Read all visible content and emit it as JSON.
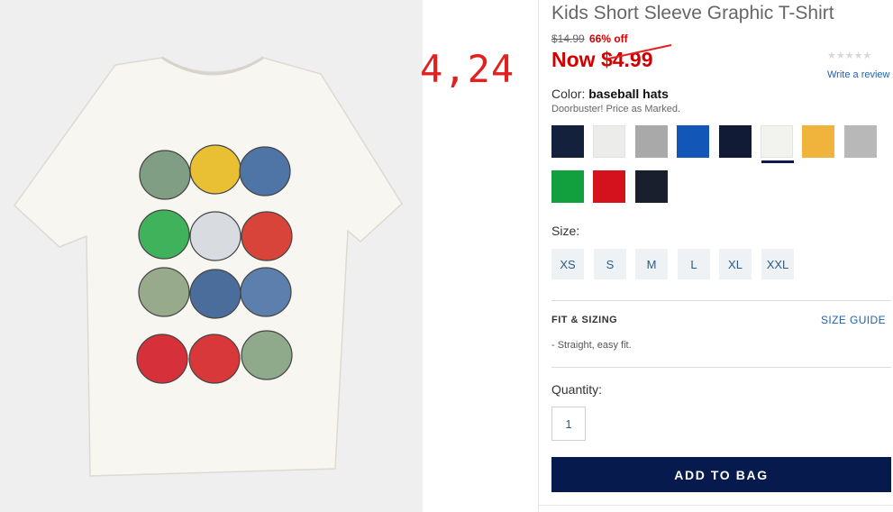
{
  "product": {
    "title": "Kids Short Sleeve Graphic T-Shirt",
    "was_price": "$14.99",
    "discount": "66% off",
    "now_prefix": "Now",
    "now_amount": "$4.99",
    "rating_stars": "★★★★★",
    "write_review": "Write a review"
  },
  "annotation": {
    "text": "4,24",
    "color": "#e32020"
  },
  "color": {
    "label": "Color:",
    "selected_name": "baseball hats",
    "note": "Doorbuster! Price as Marked.",
    "selected_index": 5,
    "swatches": [
      "#14213d",
      "#ececea",
      "#a9a9a9",
      "#1257b8",
      "#121b35",
      "#f2f2ee",
      "#f0b43c",
      "#b8b8b8",
      "#12a03f",
      "#d3121d",
      "#1a1f2e"
    ]
  },
  "size": {
    "label": "Size:",
    "options": [
      "XS",
      "S",
      "M",
      "L",
      "XL",
      "XXL"
    ]
  },
  "fit": {
    "title": "FIT & SIZING",
    "guide_link": "SIZE GUIDE",
    "note": "- Straight, easy fit."
  },
  "quantity": {
    "label": "Quantity:",
    "value": "1"
  },
  "cta": {
    "label": "ADD TO BAG",
    "bg_color": "#071a4d"
  },
  "image": {
    "alt_subject": "white t-shirt with baseball cap graphic"
  }
}
